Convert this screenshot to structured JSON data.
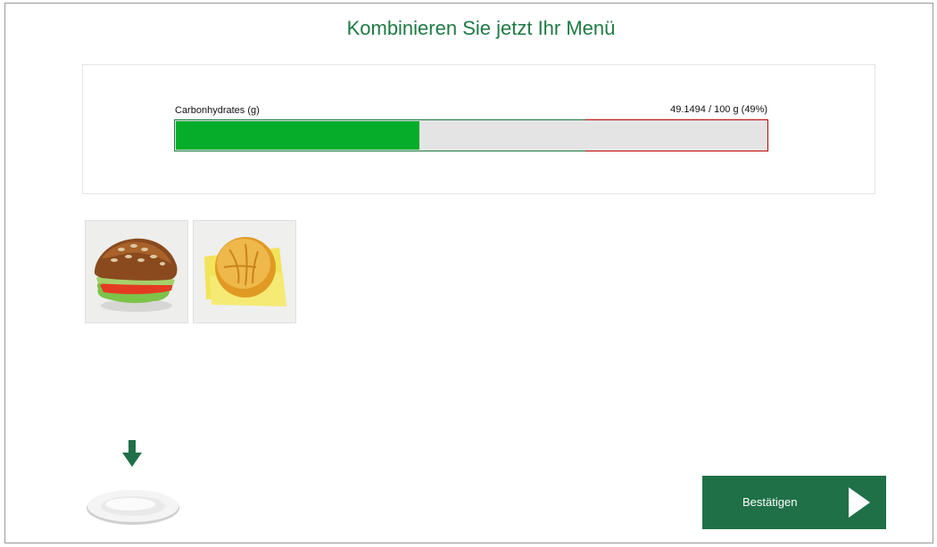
{
  "header": {
    "title": "Kombinieren Sie jetzt Ihr Menü"
  },
  "nutrient": {
    "label": "Carbonhydrates (g)",
    "value_text": "49.1494 / 100 g (49%)",
    "current": 49.1494,
    "max": 100,
    "threshold": 83,
    "scale_max": 120
  },
  "colors": {
    "accent": "#1f7047",
    "title": "#1f7a45",
    "progress_fill": "#06ad2a",
    "progress_track": "#e4e4e4",
    "over_limit": "#c00000"
  },
  "foods": [
    {
      "icon": "sandwich-image"
    },
    {
      "icon": "bread-roll-with-cheese-image"
    }
  ],
  "plate": {
    "icon": "plate-icon",
    "drop_indicator": "arrow-down-icon"
  },
  "actions": {
    "confirm_label": "Bestätigen",
    "confirm_icon": "play-triangle-icon"
  }
}
